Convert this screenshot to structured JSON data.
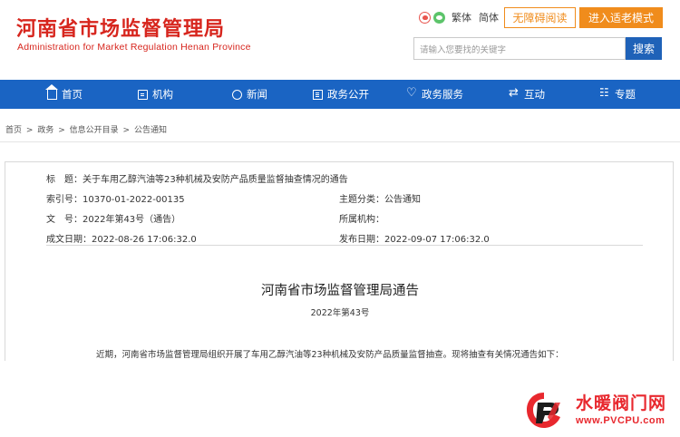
{
  "header": {
    "site_name_cn": "河南省市场监督管理局",
    "site_name_en": "Administration for Market Regulation Henan Province",
    "lang_traditional": "繁体",
    "lang_simplified": "简体",
    "accessible_reading": "无障碍阅读",
    "elder_mode": "进入适老模式",
    "search_placeholder": "请输入您要找的关键字",
    "search_button": "搜索"
  },
  "nav": {
    "items": [
      {
        "label": "首页",
        "icon": "home-icon"
      },
      {
        "label": "机构",
        "icon": "org-icon"
      },
      {
        "label": "新闻",
        "icon": "globe-icon"
      },
      {
        "label": "政务公开",
        "icon": "document-icon"
      },
      {
        "label": "政务服务",
        "icon": "heart-icon"
      },
      {
        "label": "互动",
        "icon": "swap-icon"
      },
      {
        "label": "专题",
        "icon": "grid-icon"
      }
    ]
  },
  "breadcrumb": {
    "items": [
      "首页",
      "政务",
      "信息公开目录",
      "公告通知"
    ],
    "separator": ">"
  },
  "meta": {
    "title_label": "标　题：",
    "title_value": "关于车用乙醇汽油等23种机械及安防产品质量监督抽查情况的通告",
    "index_label": "索引号：",
    "index_value": "10370-01-2022-00135",
    "category_label": "主题分类：",
    "category_value": "公告通知",
    "docno_label": "文　号：",
    "docno_value": "2022年第43号（通告）",
    "agency_label": "所属机构：",
    "agency_value": "",
    "created_label": "成文日期：",
    "created_value": "2022-08-26 17:06:32.0",
    "published_label": "发布日期：",
    "published_value": "2022-09-07 17:06:32.0"
  },
  "document": {
    "heading": "河南省市场监督管理局通告",
    "number": "2022年第43号",
    "first_line": "近期，河南省市场监督管理局组织开展了车用乙醇汽油等23种机械及安防产品质量监督抽查。现将抽查有关情况通告如下："
  },
  "watermark": {
    "name_cn": "水暖阀门网",
    "url": "www.PVCPU.com"
  },
  "colors": {
    "brand_red": "#d7261e",
    "nav_blue": "#1a64c3",
    "accent_orange": "#f08c1c"
  }
}
